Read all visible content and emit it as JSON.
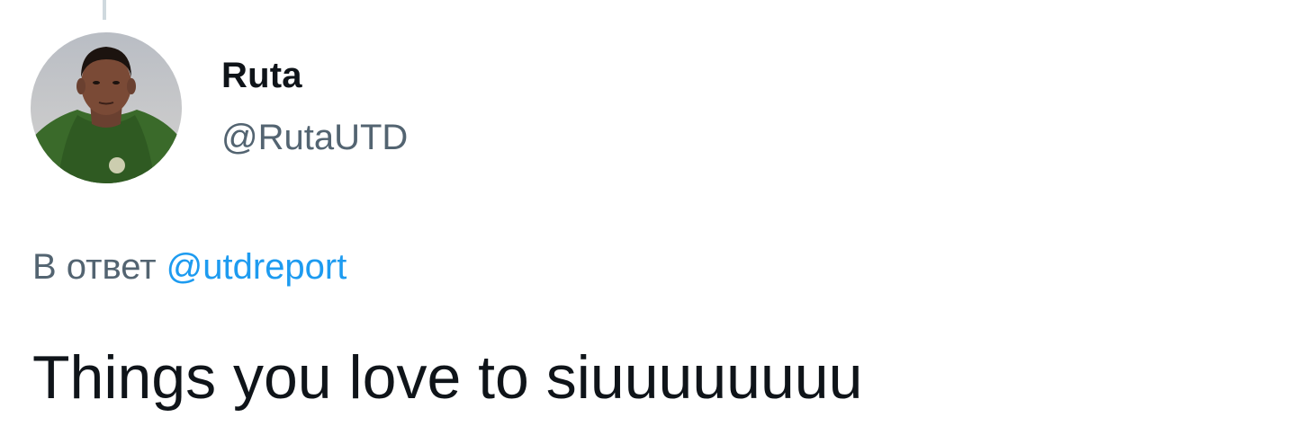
{
  "tweet": {
    "author": {
      "display_name": "Ruta",
      "handle": "@RutaUTD",
      "avatar_icon": "profile-photo"
    },
    "reply_to": {
      "prefix": "В ответ",
      "handle": "@utdreport"
    },
    "text": "Things you love to siuuuuuuuu"
  },
  "colors": {
    "text_primary": "#0f1419",
    "text_secondary": "#536471",
    "link": "#1d9bf0",
    "thread_line": "#cfd9de",
    "background": "#ffffff"
  }
}
